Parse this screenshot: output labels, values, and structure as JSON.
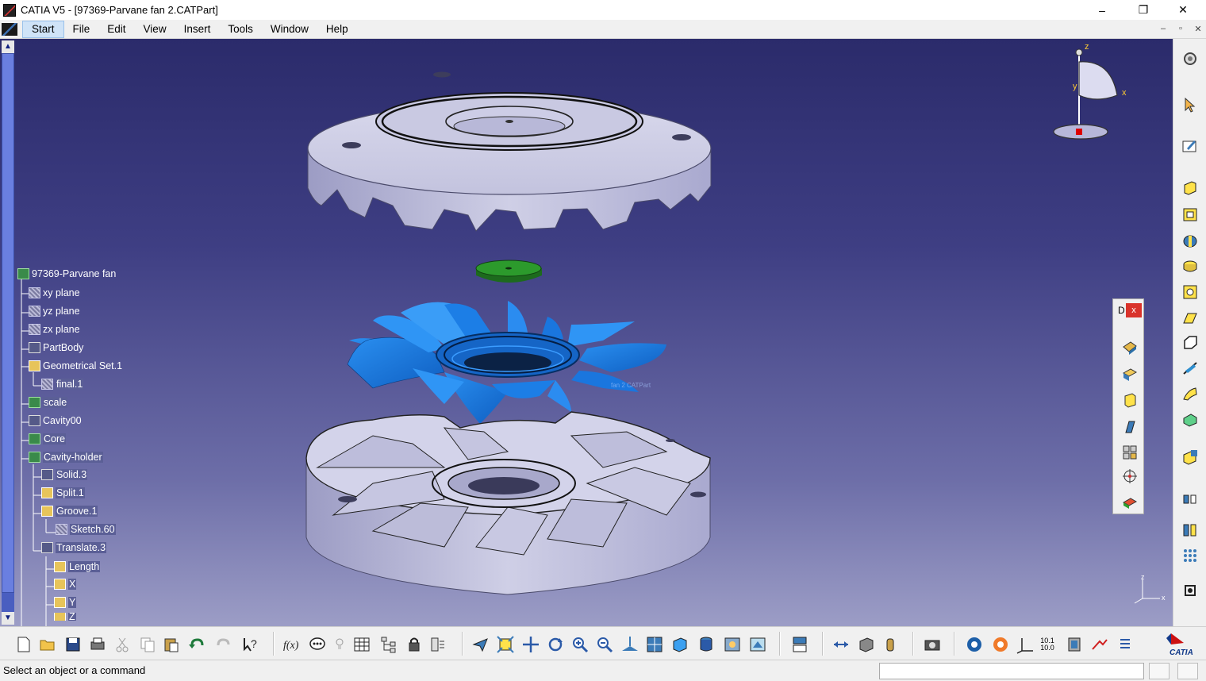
{
  "window": {
    "title": "CATIA V5 - [97369-Parvane fan 2.CATPart]",
    "controls": [
      "–",
      "❐",
      "✕"
    ]
  },
  "menu": {
    "items": [
      "Start",
      "File",
      "Edit",
      "View",
      "Insert",
      "Tools",
      "Window",
      "Help"
    ],
    "mdi_controls": [
      "–",
      "▫",
      "✕"
    ]
  },
  "tree": {
    "root": "97369-Parvane fan",
    "nodes": [
      {
        "label": "xy plane"
      },
      {
        "label": "yz plane"
      },
      {
        "label": "zx plane"
      },
      {
        "label": "PartBody"
      },
      {
        "label": "Geometrical Set.1"
      },
      {
        "label": "final.1"
      },
      {
        "label": "scale"
      },
      {
        "label": "Cavity00"
      },
      {
        "label": "Core"
      },
      {
        "label": "Cavity-holder"
      },
      {
        "label": "Solid.3"
      },
      {
        "label": "Split.1"
      },
      {
        "label": "Groove.1"
      },
      {
        "label": "Sketch.60"
      },
      {
        "label": "Translate.3"
      },
      {
        "label": "Length"
      },
      {
        "label": "X"
      },
      {
        "label": "Y"
      },
      {
        "label": "Z"
      }
    ]
  },
  "compass": {
    "x": "x",
    "y": "y",
    "z": "z"
  },
  "palette": {
    "title": "D",
    "close": "x"
  },
  "right_toolbar_icons": [
    "settings-icon",
    "select-arrow-icon",
    "sketcher-icon",
    "pad-icon",
    "pocket-icon",
    "shaft-icon",
    "groove-icon",
    "hole-icon",
    "rib-icon",
    "slot-icon",
    "stiffener-icon",
    "loft-icon",
    "fillet-icon",
    "draft-icon",
    "shell-icon",
    "pattern-icon",
    "measure-icon"
  ],
  "bottom_toolbar_icons": [
    "new-icon",
    "open-icon",
    "save-icon",
    "print-icon",
    "cut-icon",
    "copy-icon",
    "paste-icon",
    "undo-icon",
    "redo-icon",
    "whats-this-icon",
    "formula-icon",
    "knowledge-icon",
    "light-bulb-icon",
    "table-icon",
    "tree-icon",
    "lock-icon",
    "catalog-icon",
    "fly-icon",
    "fit-all-icon",
    "pan-icon",
    "rotate-icon",
    "zoom-in-icon",
    "zoom-out-icon",
    "normal-view-icon",
    "multi-view-icon",
    "iso-view-icon",
    "shading-icon",
    "material-icon",
    "apply-material-icon",
    "swap-icon",
    "measure-between-icon",
    "measure-item-icon",
    "inertia-icon",
    "capture-icon",
    "compass-icon",
    "render-icon",
    "axis-icon",
    "units-icon",
    "analysis-icon",
    "snap-icon",
    "list-icon"
  ],
  "brand": "CATIA",
  "bottom_labels": {
    "units": "10.1\n10.0"
  },
  "status": {
    "message": "Select an object or a command"
  },
  "model_overlay_text": "fan 2 CATPart"
}
